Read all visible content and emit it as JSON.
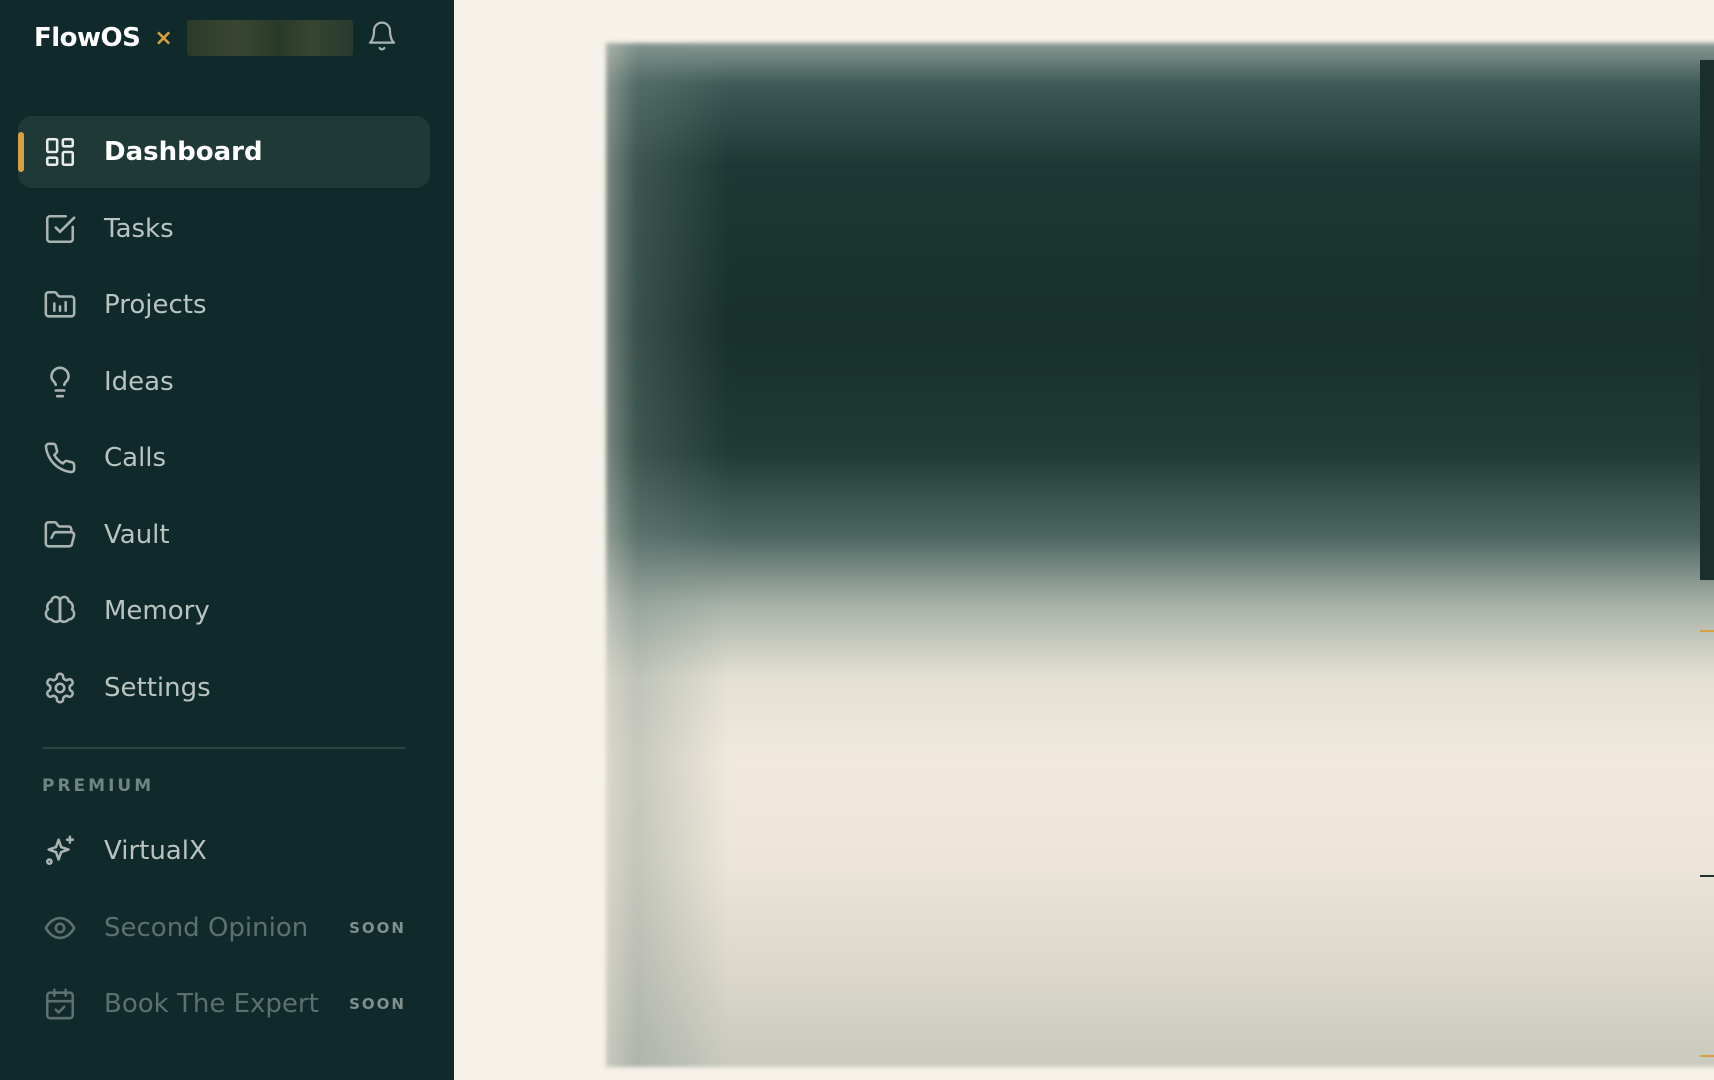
{
  "app": {
    "brand": "FlowOS",
    "separator": "×"
  },
  "nav": {
    "items": [
      {
        "label": "Dashboard",
        "icon": "grid-icon",
        "active": true
      },
      {
        "label": "Tasks",
        "icon": "checkbox-icon"
      },
      {
        "label": "Projects",
        "icon": "folder-chart-icon"
      },
      {
        "label": "Ideas",
        "icon": "lightbulb-icon"
      },
      {
        "label": "Calls",
        "icon": "phone-icon"
      },
      {
        "label": "Vault",
        "icon": "folder-open-icon"
      },
      {
        "label": "Memory",
        "icon": "brain-icon"
      },
      {
        "label": "Settings",
        "icon": "gear-icon"
      }
    ]
  },
  "premium": {
    "section_label": "PREMIUM",
    "items": [
      {
        "label": "VirtualX",
        "icon": "sparkles-icon",
        "badge": ""
      },
      {
        "label": "Second Opinion",
        "icon": "eye-icon",
        "badge": "SOON"
      },
      {
        "label": "Book The Expert",
        "icon": "calendar-check-icon",
        "badge": "SOON"
      }
    ]
  },
  "colors": {
    "sidebar_bg": "#10292a",
    "active_bg": "#1f3937",
    "accent": "#d6a23f",
    "main_bg": "#f6f1e9"
  }
}
